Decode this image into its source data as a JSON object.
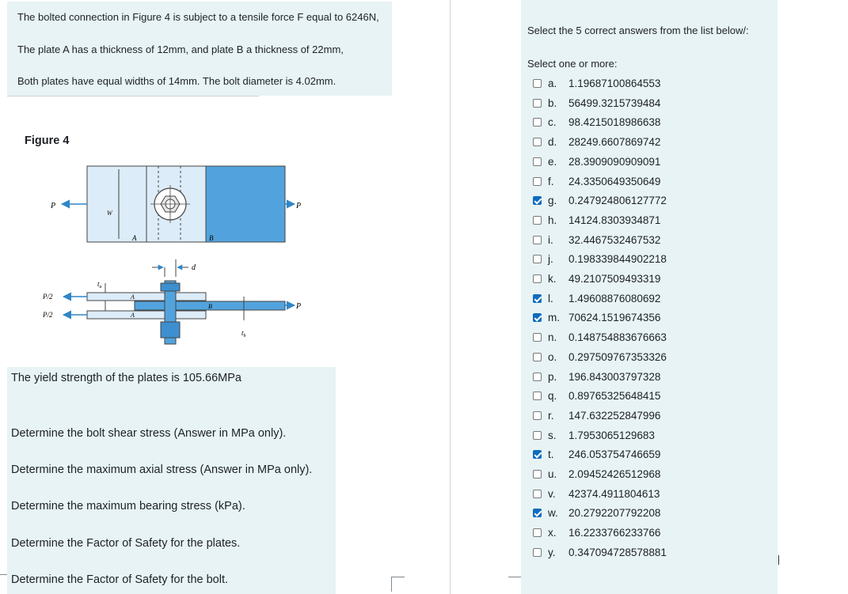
{
  "question": {
    "line1": "The bolted connection in Figure 4 is subject to a tensile force F equal to 6246N,",
    "line2": "The plate A has a thickness of 12mm, and plate B a thickness of 22mm,",
    "line3": "Both plates have equal widths of 14mm. The bolt diameter is 4.02mm.",
    "figure_caption": "Figure 4",
    "yield": "The yield strength of the plates is 105.66MPa",
    "tasks": [
      "Determine the bolt shear stress (Answer in MPa only).",
      "Determine the maximum axial stress (Answer in MPa only).",
      "Determine the maximum bearing stress (kPa).",
      "Determine the Factor of Safety for the plates.",
      "Determine the Factor of Safety for the bolt."
    ]
  },
  "figure": {
    "labels": {
      "P": "P",
      "W": "W",
      "A": "A",
      "B": "B",
      "d": "d",
      "ta": "t",
      "ta_sub": "a",
      "tb": "t",
      "tb_sub": "b",
      "P2": "P/2"
    },
    "colors": {
      "plate_light": "#dcecf8",
      "plate_blue": "#52a3dd",
      "arrow": "#2f86c8",
      "line": "#333333"
    }
  },
  "answers": {
    "instruction": "Select the 5 correct answers from the list below/:",
    "prompt": "Select one or more:",
    "options": [
      {
        "letter": "a.",
        "value": "1.19687100864553",
        "checked": false
      },
      {
        "letter": "b.",
        "value": "56499.3215739484",
        "checked": false
      },
      {
        "letter": "c.",
        "value": "98.4215018986638",
        "checked": false
      },
      {
        "letter": "d.",
        "value": "28249.6607869742",
        "checked": false
      },
      {
        "letter": "e.",
        "value": "28.3909090909091",
        "checked": false
      },
      {
        "letter": "f.",
        "value": "24.3350649350649",
        "checked": false
      },
      {
        "letter": "g.",
        "value": "0.247924806127772",
        "checked": true
      },
      {
        "letter": "h.",
        "value": "14124.8303934871",
        "checked": false
      },
      {
        "letter": "i.",
        "value": "32.4467532467532",
        "checked": false
      },
      {
        "letter": "j.",
        "value": "0.198339844902218",
        "checked": false
      },
      {
        "letter": "k.",
        "value": "49.2107509493319",
        "checked": false
      },
      {
        "letter": "l.",
        "value": "1.49608876080692",
        "checked": true
      },
      {
        "letter": "m.",
        "value": "70624.1519674356",
        "checked": true
      },
      {
        "letter": "n.",
        "value": "0.148754883676663",
        "checked": false
      },
      {
        "letter": "o.",
        "value": "0.297509767353326",
        "checked": false
      },
      {
        "letter": "p.",
        "value": "196.843003797328",
        "checked": false
      },
      {
        "letter": "q.",
        "value": "0.89765325648415",
        "checked": false
      },
      {
        "letter": "r.",
        "value": "147.632252847996",
        "checked": false
      },
      {
        "letter": "s.",
        "value": "1.7953065129683",
        "checked": false
      },
      {
        "letter": "t.",
        "value": "246.053754746659",
        "checked": true
      },
      {
        "letter": "u.",
        "value": "2.09452426512968",
        "checked": false
      },
      {
        "letter": "v.",
        "value": "42374.4911804613",
        "checked": false
      },
      {
        "letter": "w.",
        "value": "20.2792207792208",
        "checked": true
      },
      {
        "letter": "x.",
        "value": "16.2233766233766",
        "checked": false
      },
      {
        "letter": "y.",
        "value": "0.347094728578881",
        "checked": false
      }
    ]
  }
}
